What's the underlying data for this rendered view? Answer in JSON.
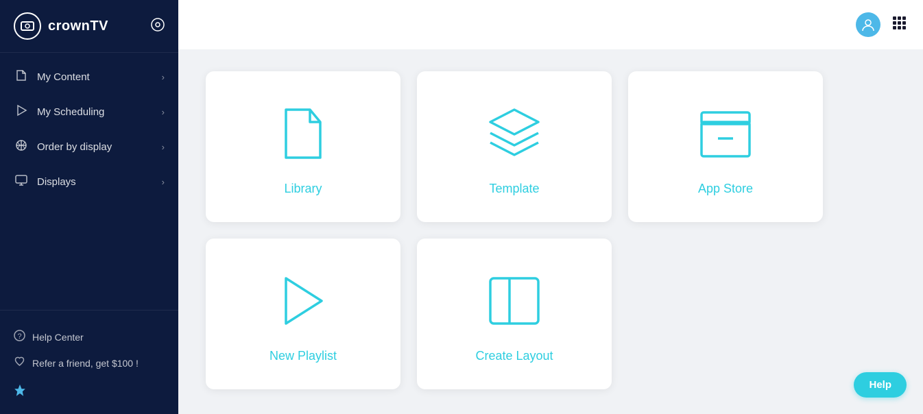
{
  "sidebar": {
    "logo_text": "crownTV",
    "settings_icon": "⚙",
    "logo_icon": "▶",
    "nav_items": [
      {
        "id": "my-content",
        "label": "My Content",
        "icon": "📄"
      },
      {
        "id": "my-scheduling",
        "label": "My Scheduling",
        "icon": "▷"
      },
      {
        "id": "order-by-display",
        "label": "Order by display",
        "icon": "✥"
      },
      {
        "id": "displays",
        "label": "Displays",
        "icon": "📺"
      }
    ],
    "footer_items": [
      {
        "id": "help-center",
        "label": "Help Center",
        "icon": "?"
      },
      {
        "id": "refer",
        "label": "Refer a friend, get $100 !",
        "icon": "♡"
      }
    ],
    "pin_icon": "📌"
  },
  "header": {
    "avatar_icon": "👤",
    "grid_icon": "⋮⋮⋮"
  },
  "cards": [
    {
      "id": "library",
      "label": "Library"
    },
    {
      "id": "template",
      "label": "Template"
    },
    {
      "id": "app-store",
      "label": "App Store"
    },
    {
      "id": "new-playlist",
      "label": "New Playlist"
    },
    {
      "id": "create-layout",
      "label": "Create Layout"
    }
  ],
  "help_button_label": "Help"
}
